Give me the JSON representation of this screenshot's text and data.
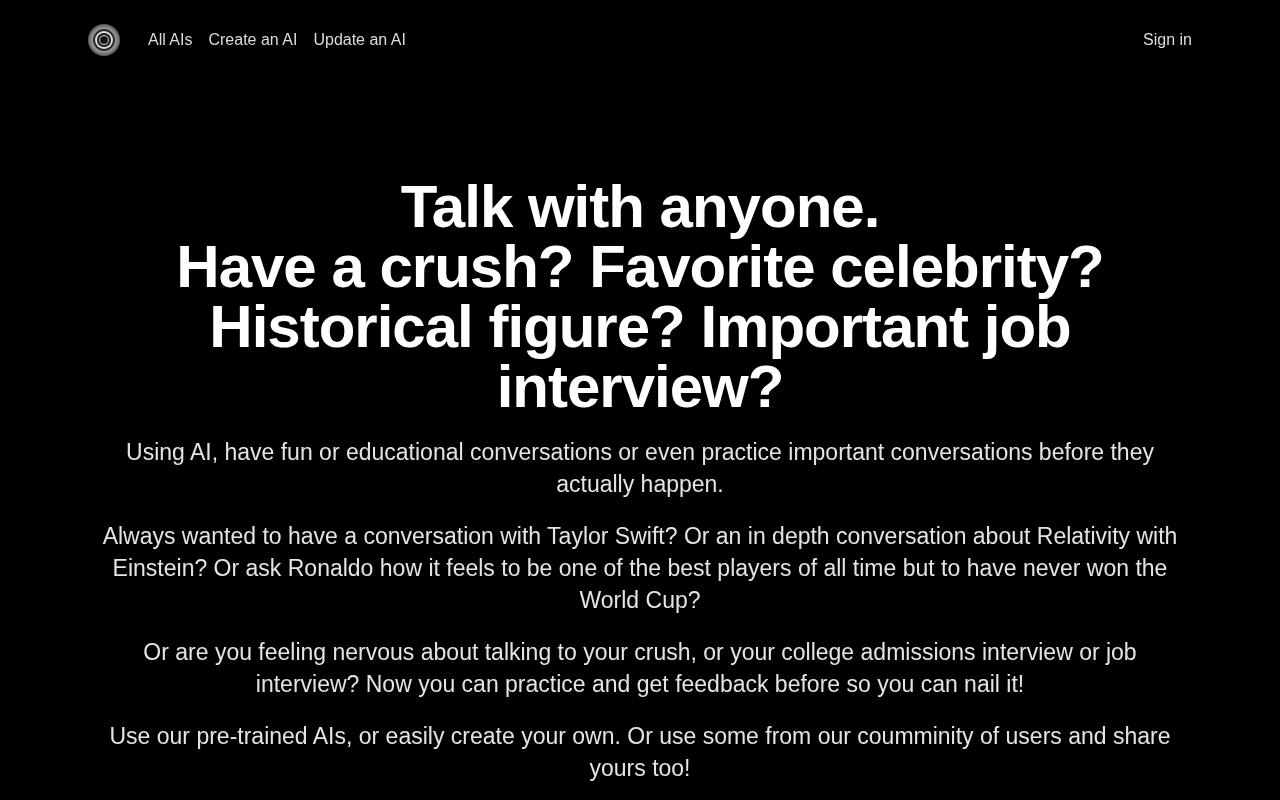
{
  "navbar": {
    "links": [
      {
        "label": "All AIs"
      },
      {
        "label": "Create an AI"
      },
      {
        "label": "Update an AI"
      }
    ],
    "sign_in": "Sign in"
  },
  "hero": {
    "headings": [
      "Talk with anyone.",
      "Have a crush? Favorite celebrity? Historical figure? Important job interview?"
    ],
    "paragraphs": [
      "Using AI, have fun or educational conversations or even practice important conversations before they actually happen.",
      "Always wanted to have a conversation with Taylor Swift? Or an in depth conversation about Relativity with Einstein? Or ask Ronaldo how it feels to be one of the best players of all time but to have never won the World Cup?",
      "Or are you feeling nervous about talking to your crush, or your college admissions interview or job interview? Now you can practice and get feedback before so you can nail it!",
      "Use our pre-trained AIs, or easily create your own. Or use some from our coumminity of users and share yours too!"
    ]
  }
}
